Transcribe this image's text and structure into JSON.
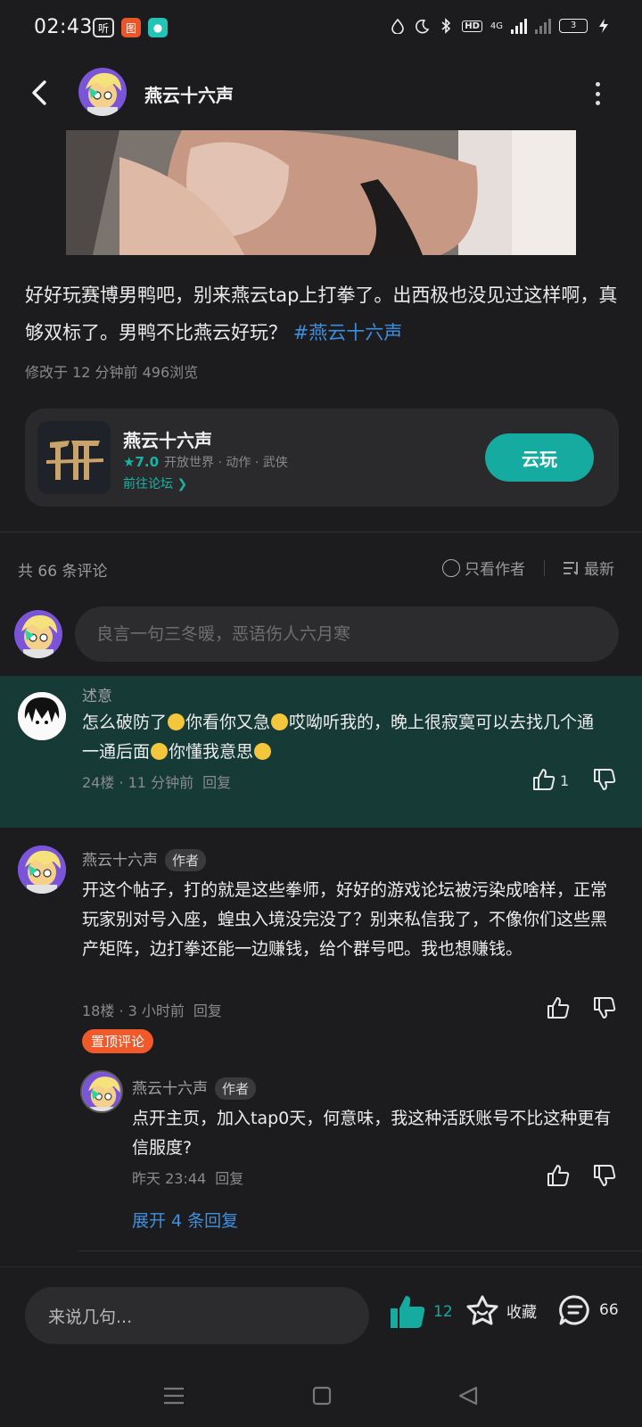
{
  "status_bar": {
    "time": "02:43",
    "app1": "听",
    "app2": "图",
    "hd": "HD",
    "net": "4G",
    "battery": "3"
  },
  "header": {
    "username": "燕云十六声"
  },
  "post": {
    "text": "好好玩赛博男鸭吧，别来燕云tap上打拳了。出西极也没见过这样啊，真够双标了。男鸭不比燕云好玩？",
    "hashtag": "#燕云十六声",
    "meta": "修改于 12 分钟前  496浏览"
  },
  "game_card": {
    "title": "燕云十六声",
    "rating": "7.0",
    "tags": "开放世界 · 动作 · 武侠",
    "forum_link": "前往论坛",
    "cloud_button": "云玩"
  },
  "comments_header": {
    "count": "共 66 条评论",
    "only_author": "只看作者",
    "sort": "最新"
  },
  "comment_input": {
    "placeholder": "良言一句三冬暖，恶语伤人六月寒"
  },
  "comments": [
    {
      "name": "述意",
      "text_a": "怎么破防了",
      "text_b": "你看你又急",
      "text_c": "哎呦听我的，晚上很寂寞可以去找几个通一通后面",
      "text_d": "你懂我意思",
      "meta": "24楼 · 11 分钟前",
      "reply": "回复",
      "likes": "1"
    },
    {
      "name": "燕云十六声",
      "author_tag": "作者",
      "text": "开这个帖子，打的就是这些拳师，好好的游戏论坛被污染成啥样，正常玩家别对号入座，蝗虫入境没完没了？别来私信我了，不像你们这些黑产矩阵，边打拳还能一边赚钱，给个群号吧。我也想赚钱。",
      "meta": "18楼 · 3 小时前",
      "reply": "回复",
      "pinned": "置顶评论"
    }
  ],
  "sub_reply": {
    "name": "燕云十六声",
    "author_tag": "作者",
    "text": "点开主页，加入tap0天，何意味，我这种活跃账号不比这种更有信服度?",
    "meta": "昨天 23:44",
    "reply": "回复",
    "expand": "展开 4 条回复"
  },
  "bottom_bar": {
    "input_placeholder": "来说几句...",
    "likes": "12",
    "favorite": "收藏",
    "comments": "66"
  },
  "colors": {
    "accent": "#15aba0",
    "link": "#3d8fe0",
    "highlight_bg": "#163b36",
    "pin": "#f05a2a"
  }
}
